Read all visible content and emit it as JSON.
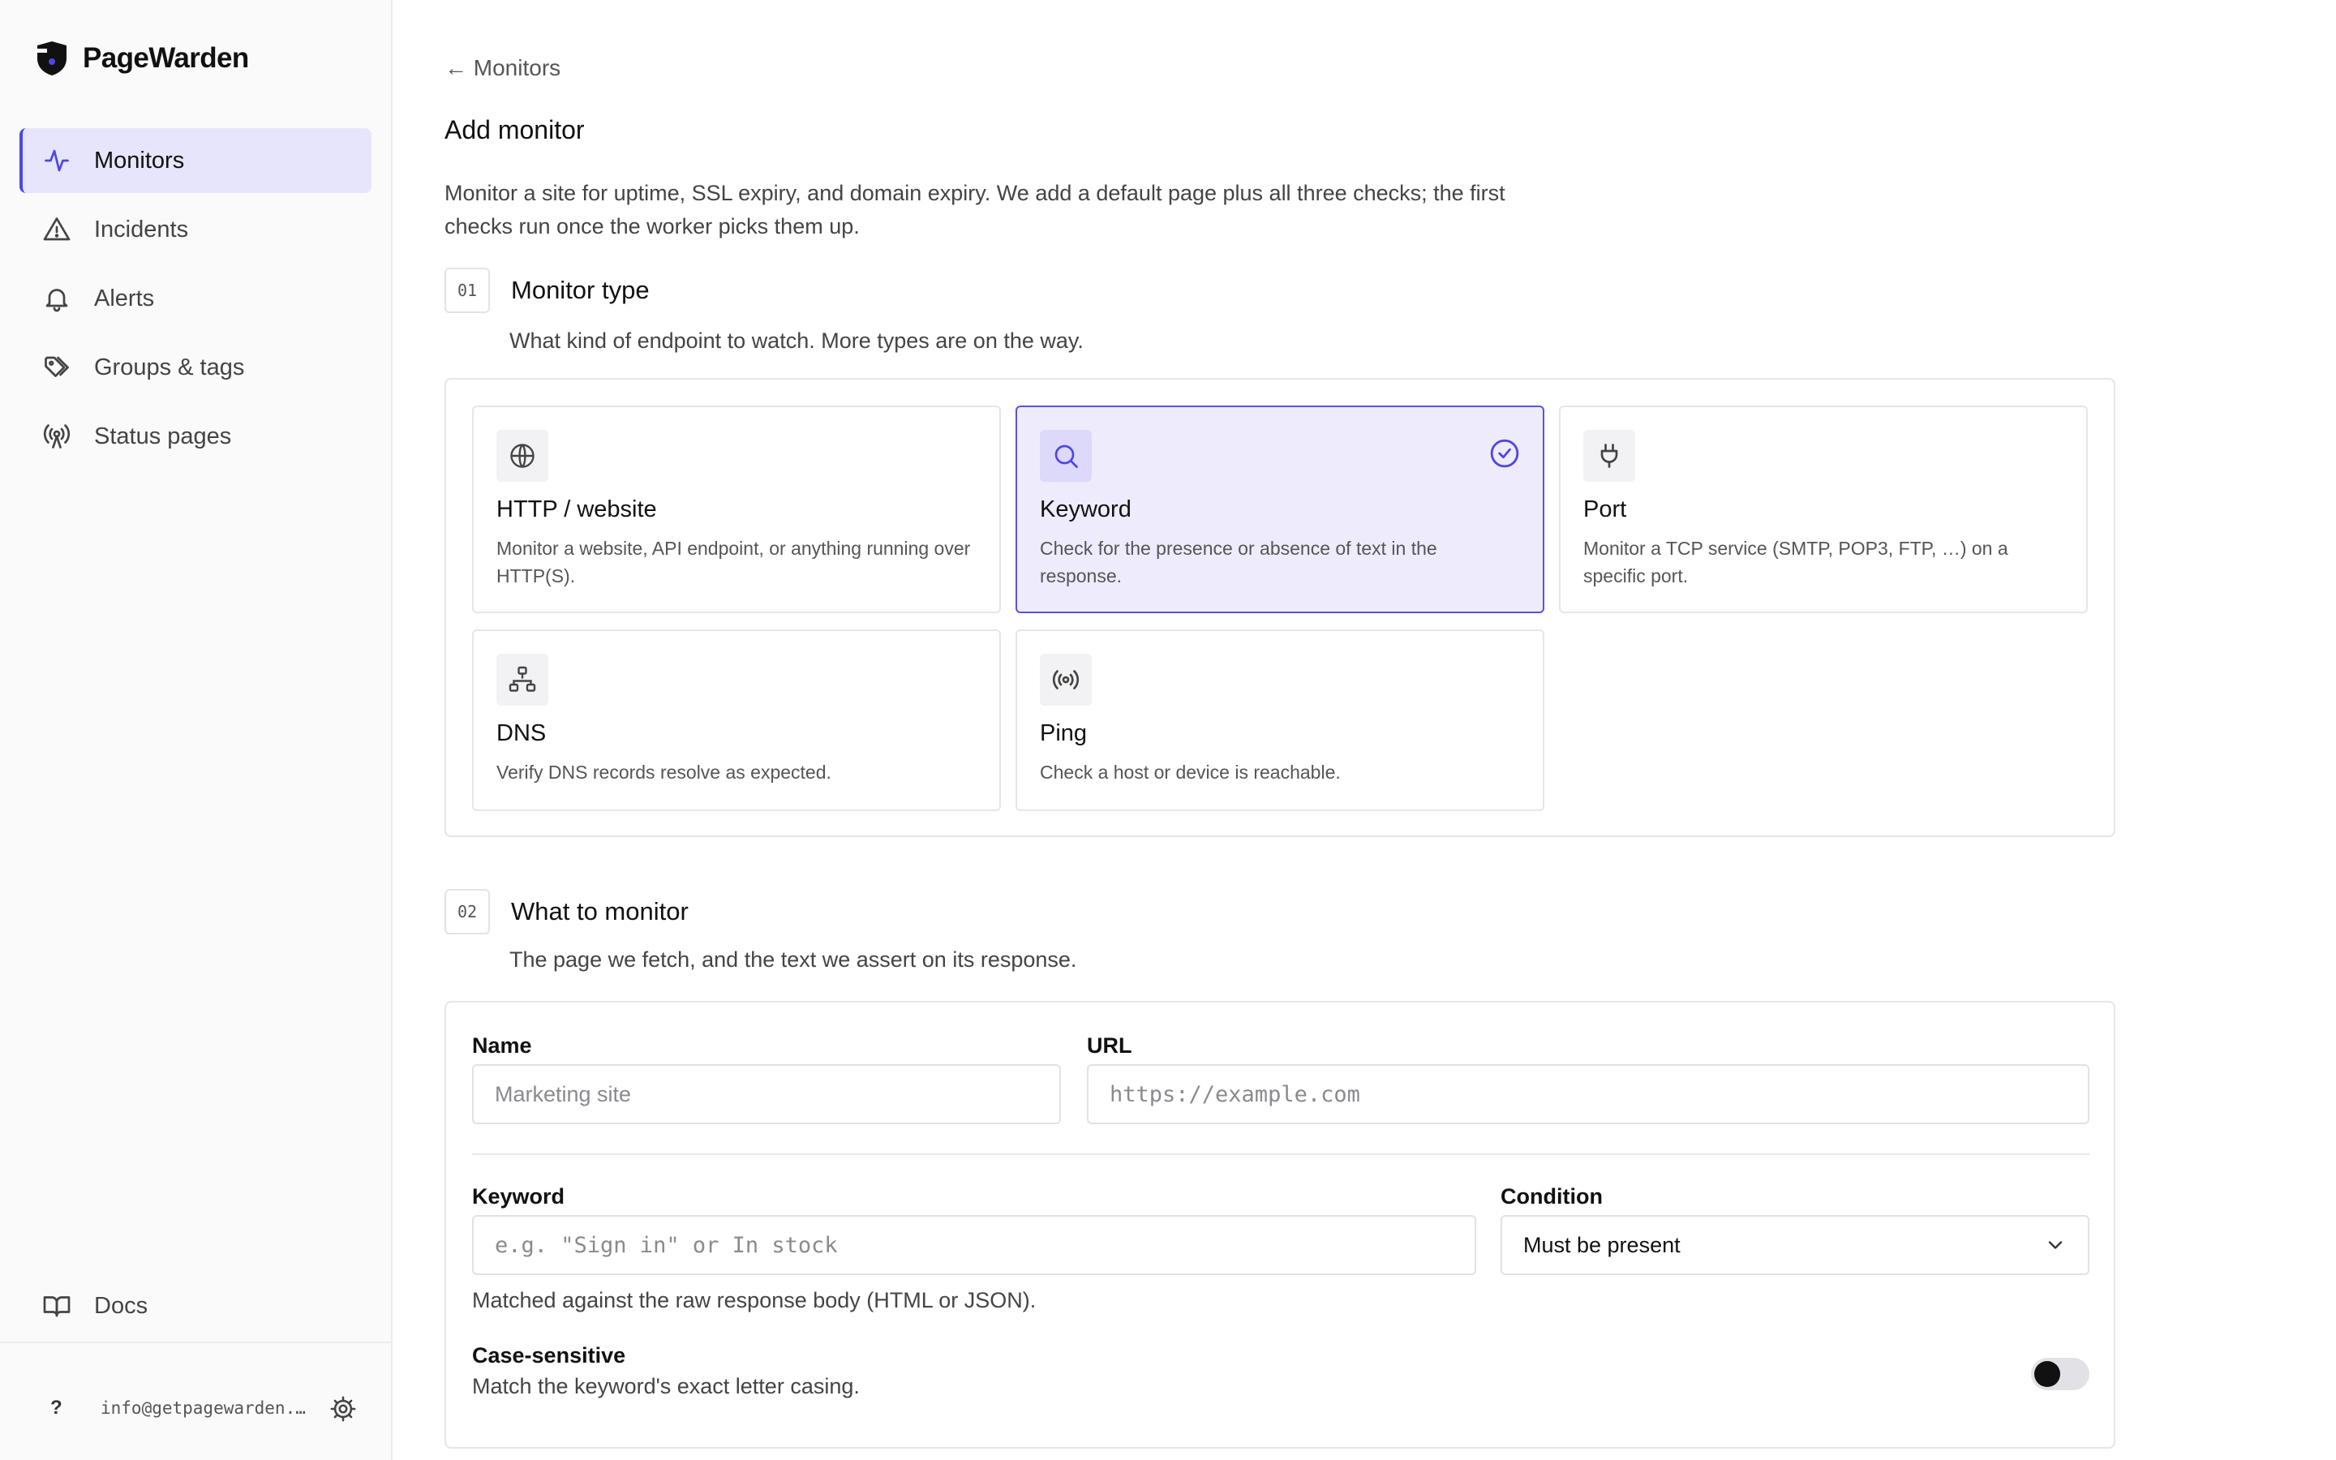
{
  "brand": {
    "name": "PageWarden"
  },
  "sidebar": {
    "items": [
      {
        "label": "Monitors",
        "icon": "activity-icon",
        "active": true
      },
      {
        "label": "Incidents",
        "icon": "alert-triangle-icon",
        "active": false
      },
      {
        "label": "Alerts",
        "icon": "bell-icon",
        "active": false
      },
      {
        "label": "Groups & tags",
        "icon": "tags-icon",
        "active": false
      },
      {
        "label": "Status pages",
        "icon": "broadcast-icon",
        "active": false
      }
    ],
    "docs_label": "Docs",
    "footer": {
      "help": "?",
      "email": "info@getpagewarden.com"
    }
  },
  "colors": {
    "accent": "#4f46e5",
    "active_bg": "#e7e5fb",
    "selected_card_bg": "#eeecfc"
  },
  "header": {
    "back_label": "← Monitors",
    "title": "Add monitor",
    "description": "Monitor a site for uptime, SSL expiry, and domain expiry. We add a default page plus all three checks; the first checks run once the worker picks them up."
  },
  "section1": {
    "step": "01",
    "title": "Monitor type",
    "description": "What kind of endpoint to watch. More types are on the way.",
    "types": [
      {
        "title": "HTTP / website",
        "description": "Monitor a website, API endpoint, or anything running over HTTP(S).",
        "icon": "globe-icon",
        "selected": false
      },
      {
        "title": "Keyword",
        "description": "Check for the presence or absence of text in the response.",
        "icon": "search-icon",
        "selected": true
      },
      {
        "title": "Port",
        "description": "Monitor a TCP service (SMTP, POP3, FTP, …) on a specific port.",
        "icon": "plug-icon",
        "selected": false
      },
      {
        "title": "DNS",
        "description": "Verify DNS records resolve as expected.",
        "icon": "network-icon",
        "selected": false
      },
      {
        "title": "Ping",
        "description": "Check a host or device is reachable.",
        "icon": "radio-icon",
        "selected": false
      }
    ]
  },
  "section2": {
    "step": "02",
    "title": "What to monitor",
    "description": "The page we fetch, and the text we assert on its response.",
    "name_label": "Name",
    "name_placeholder": "Marketing site",
    "url_label": "URL",
    "url_placeholder": "https://example.com",
    "keyword_label": "Keyword",
    "keyword_placeholder": "e.g. \"Sign in\" or In stock",
    "condition_label": "Condition",
    "condition_value": "Must be present",
    "keyword_hint": "Matched against the raw response body (HTML or JSON).",
    "case_label": "Case-sensitive",
    "case_hint": "Match the keyword's exact letter casing.",
    "case_enabled": false
  }
}
